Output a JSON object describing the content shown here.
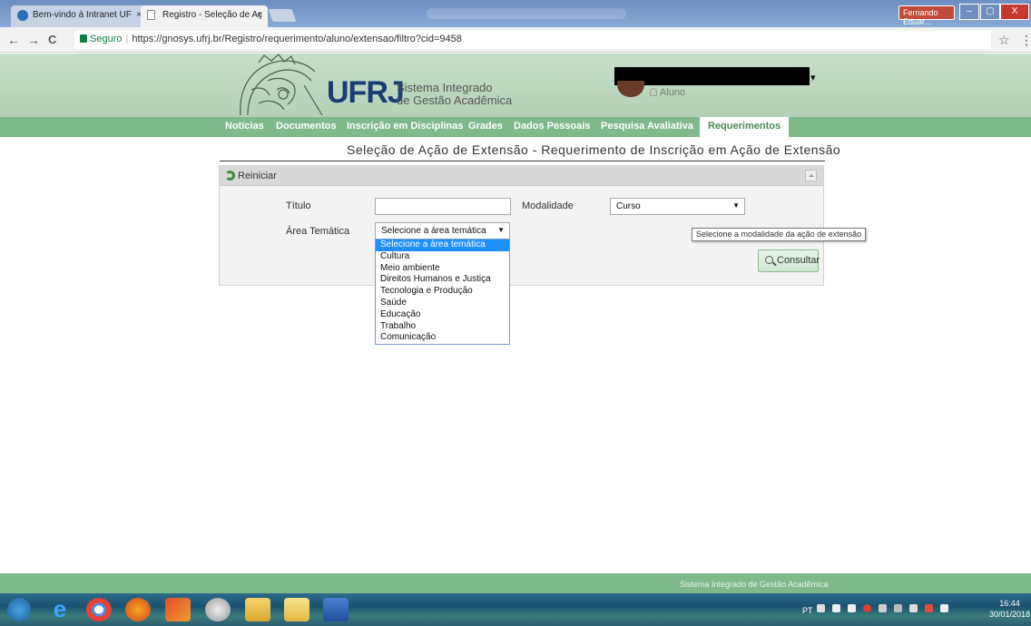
{
  "browser": {
    "tabs": [
      {
        "label": "Bem-vindo à Intranet UF",
        "close": "×"
      },
      {
        "label": "Registro - Seleção de Aç",
        "close": "×"
      }
    ],
    "user_badge": "Fernando Eduar...",
    "window_controls": {
      "minimize": "–",
      "maximize": "▢",
      "close": "X"
    },
    "nav": {
      "back": "←",
      "forward": "→",
      "reload": "C"
    },
    "security_label": "Seguro",
    "url_sep": "|",
    "url": "https://gnosys.ufrj.br/Registro/requerimento/aluno/extensao/filtro?cid=9458",
    "star": "☆",
    "menu": "⋮"
  },
  "header": {
    "brand": "UFRJ",
    "system_name_line1": "Sistema Integrado",
    "system_name_line2": "de Gestão Acadêmica",
    "profile_role": "Aluno",
    "profile_caret": "▾"
  },
  "menu": {
    "items": [
      {
        "label": "Notícias"
      },
      {
        "label": "Documentos"
      },
      {
        "label": "Inscrição em Disciplinas"
      },
      {
        "label": "Grades"
      },
      {
        "label": "Dados Pessoais"
      },
      {
        "label": "Pesquisa Avaliativa"
      },
      {
        "label": "Requerimentos",
        "active": true
      }
    ]
  },
  "page": {
    "title": "Seleção de Ação de Extensão - Requerimento de Inscrição em Ação de Extensão"
  },
  "form": {
    "reset_label": "Reiniciar",
    "titulo_label": "Título",
    "titulo_value": "",
    "modalidade_label": "Modalidade",
    "modalidade_value": "Curso",
    "area_label": "Área Temática",
    "area_value": "Selecione a área temática",
    "submit_label": "Consultar",
    "caret": "▼",
    "tooltip": "Selecione a modalidade da ação de extensão",
    "area_options": [
      "Selecione a área temática",
      "Cultura",
      "Meio ambiente",
      "Direitos Humanos e Justiça",
      "Tecnologia e Produção",
      "Saúde",
      "Educação",
      "Trabalho",
      "Comunicação"
    ]
  },
  "footer": {
    "text": "Sistema Integrado de Gestão Acadêmica"
  },
  "taskbar": {
    "language": "PT",
    "time": "16:44",
    "date": "30/01/2018"
  },
  "colors": {
    "menu_green": "#7fb98a",
    "brand_blue": "#1a3e72",
    "select_highlight": "#1e90ff"
  }
}
